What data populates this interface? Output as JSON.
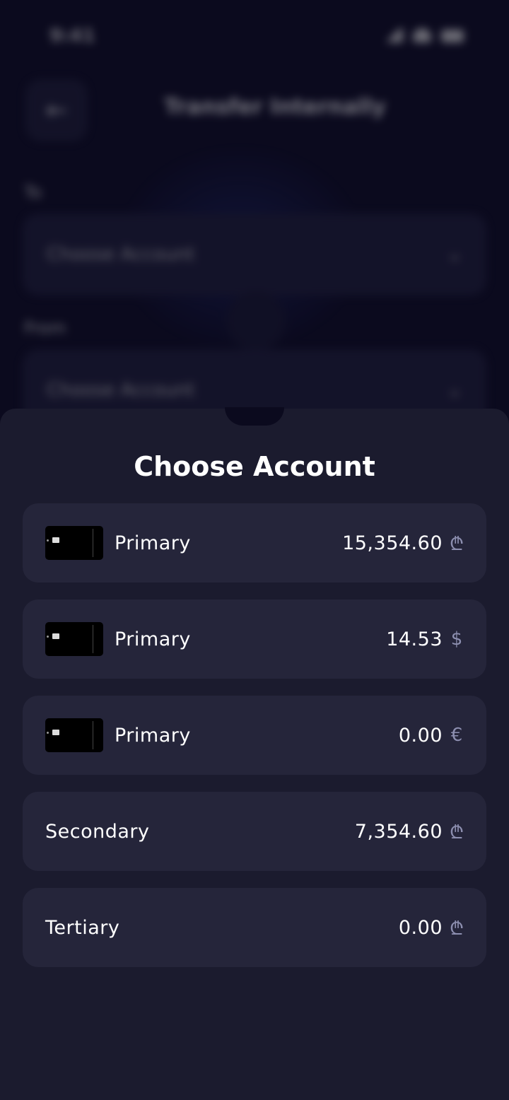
{
  "status": {
    "time": "9:41"
  },
  "background_screen": {
    "title": "Transfer Internally",
    "to_label": "To",
    "from_label": "From",
    "to_placeholder": "Choose Account",
    "from_placeholder": "Choose Account"
  },
  "sheet": {
    "title": "Choose Account",
    "accounts": [
      {
        "name": "Primary",
        "amount": "15,354.60",
        "currency": "₾",
        "has_card": true
      },
      {
        "name": "Primary",
        "amount": "14.53",
        "currency": "$",
        "has_card": true
      },
      {
        "name": "Primary",
        "amount": "0.00",
        "currency": "€",
        "has_card": true
      },
      {
        "name": "Secondary",
        "amount": "7,354.60",
        "currency": "₾",
        "has_card": false
      },
      {
        "name": "Tertiary",
        "amount": "0.00",
        "currency": "₾",
        "has_card": false
      }
    ]
  },
  "colors": {
    "background": "#0b0a1e",
    "sheet": "#1b1b2e",
    "row": "#25253a",
    "currency": "#8d8fb0"
  }
}
